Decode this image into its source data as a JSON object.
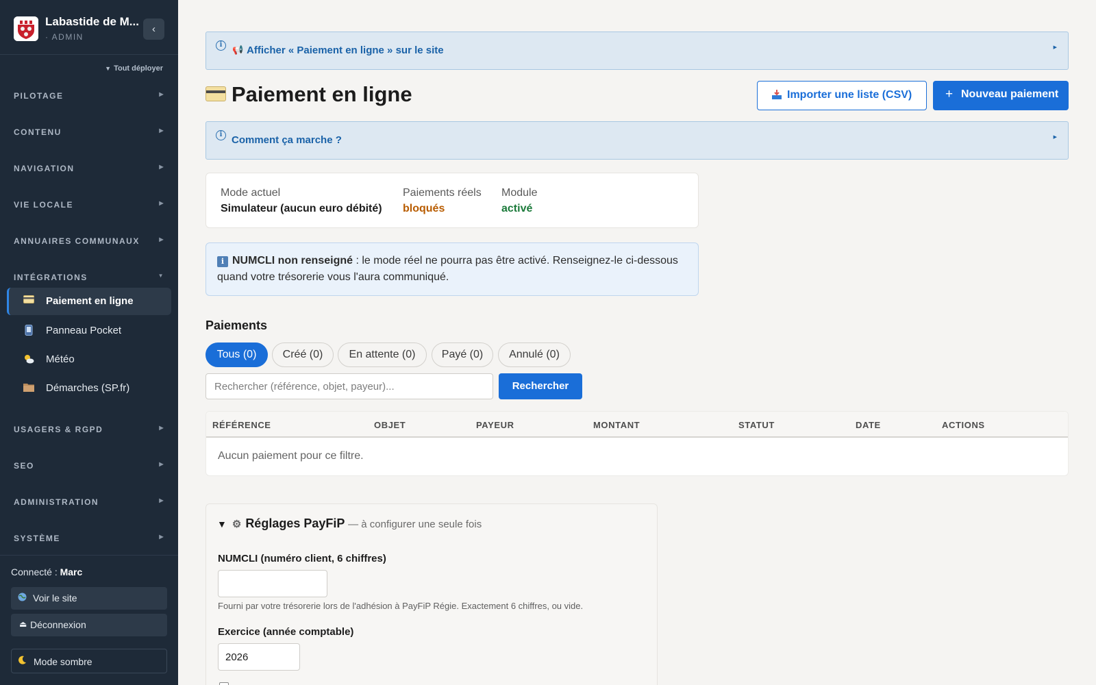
{
  "sidebar": {
    "brand_name": "Labastide de M...",
    "brand_sub": "· ADMIN",
    "collapse_icon": "‹",
    "expand_all": "Tout déployer",
    "sections": {
      "pilotage": "PILOTAGE",
      "contenu": "CONTENU",
      "navigation": "NAVIGATION",
      "vie_locale": "VIE LOCALE",
      "annuaires": "ANNUAIRES COMMUNAUX",
      "integrations": "INTÉGRATIONS",
      "usagers": "USAGERS & RGPD",
      "seo": "SEO",
      "administration": "ADMINISTRATION",
      "systeme": "SYSTÈME"
    },
    "items": [
      {
        "label": "Paiement en ligne",
        "icon": "credit-card-icon"
      },
      {
        "label": "Panneau Pocket",
        "icon": "phone-icon"
      },
      {
        "label": "Météo",
        "icon": "sun-cloud-icon"
      },
      {
        "label": "Démarches (SP.fr)",
        "icon": "folder-icon"
      }
    ],
    "connected_label": "Connecté : ",
    "connected_user": "Marc",
    "view_site": "Voir le site",
    "logout": "Déconnexion",
    "dark_mode": "Mode sombre"
  },
  "banners": {
    "top": "Afficher « Paiement en ligne » sur le site",
    "how": "Comment ça marche ?"
  },
  "page": {
    "title": "Paiement en ligne",
    "import_button": "Importer une liste (CSV)",
    "new_button": "Nouveau paiement"
  },
  "status": {
    "mode_label": "Mode actuel",
    "mode_value": "Simulateur (aucun euro débité)",
    "real_label": "Paiements réels",
    "real_value": "bloqués",
    "module_label": "Module",
    "module_value": "activé",
    "colors": {
      "blocked": "#b85c00",
      "active": "#1b7a3a"
    }
  },
  "notice": {
    "bold": "NUMCLI non renseigné",
    "text": " : le mode réel ne pourra pas être activé. Renseignez-le ci-dessous quand votre trésorerie vous l'aura communiqué."
  },
  "payments": {
    "title": "Paiements",
    "filters": [
      "Tous (0)",
      "Créé (0)",
      "En attente (0)",
      "Payé (0)",
      "Annulé (0)"
    ],
    "search_placeholder": "Rechercher (référence, objet, payeur)...",
    "search_button": "Rechercher",
    "columns": [
      "RÉFÉRENCE",
      "OBJET",
      "PAYEUR",
      "MONTANT",
      "STATUT",
      "DATE",
      "ACTIONS"
    ],
    "empty": "Aucun paiement pour ce filtre."
  },
  "payfip": {
    "title": "Réglages PayFiP",
    "subtitle": "— à configurer une seule fois",
    "numcli_label": "NUMCLI (numéro client, 6 chiffres)",
    "numcli_value": "",
    "numcli_help": "Fourni par votre trésorerie lors de l'adhésion à PayFiP Régie. Exactement 6 chiffres, ou vide.",
    "exercice_label": "Exercice (année comptable)",
    "exercice_value": "2026"
  },
  "accent_color": "#1a6ed8"
}
